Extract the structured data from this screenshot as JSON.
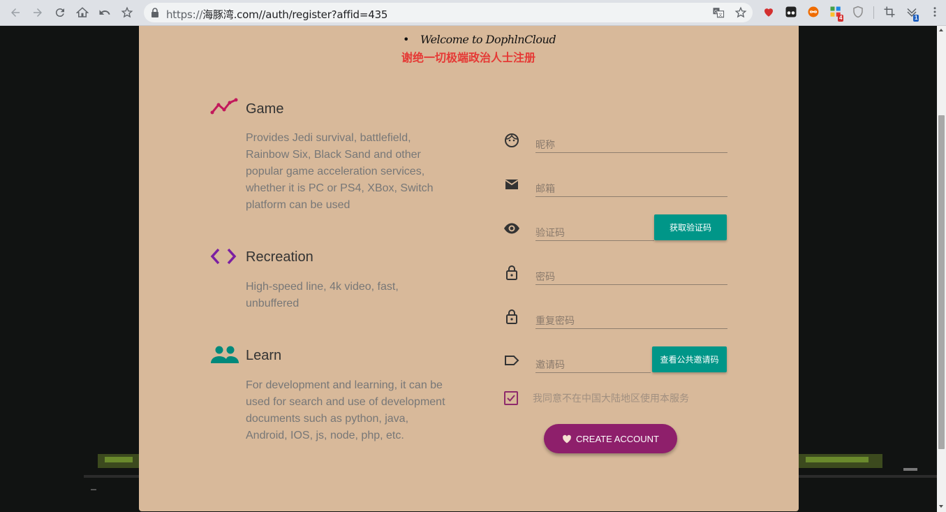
{
  "browser": {
    "url_scheme": "https://",
    "url_rest": "海豚湾.com//auth/register?affid=435",
    "ext_badge_1": "4",
    "ext_badge_2": "1",
    "icons": [
      "back-icon",
      "forward-icon",
      "reload-icon",
      "home-icon",
      "undo-icon",
      "star-icon",
      "lock-icon",
      "translate-icon",
      "bookmark-star-icon",
      "heart-extension-icon",
      "tampermonkey-icon",
      "infinity-extension-icon",
      "puzzle-extension-icon",
      "shield-extension-icon",
      "crop-icon",
      "download-extension-icon",
      "menu-icon"
    ]
  },
  "header": {
    "welcome": "Welcome to DophlnCloud",
    "warning": "谢绝一切极端政治人士注册"
  },
  "features": [
    {
      "title": "Game",
      "icon": "trending-icon",
      "color": "#c2185b",
      "desc": "Provides Jedi survival, battlefield, Rainbow Six, Black Sand and other popular game acceleration services, whether it is PC or PS4, XBox, Switch platform can be used"
    },
    {
      "title": "Recreation",
      "icon": "code-icon",
      "color": "#7b1fa2",
      "desc": "High-speed line, 4k video, fast, unbuffered"
    },
    {
      "title": "Learn",
      "icon": "people-icon",
      "color": "#00897b",
      "desc": "For development and learning, it can be used for search and use of development documents such as python, java, Android, IOS, js, node, php, etc."
    }
  ],
  "form": {
    "nickname_placeholder": "昵称",
    "email_placeholder": "邮箱",
    "code_placeholder": "验证码",
    "get_code_label": "获取验证码",
    "password_placeholder": "密码",
    "repeat_password_placeholder": "重复密码",
    "invite_placeholder": "邀请码",
    "view_invite_label": "查看公共邀请码",
    "agree_label": "我同意不在中国大陆地区使用本服务",
    "agree_checked": true,
    "create_label": "CREATE ACCOUNT"
  },
  "colors": {
    "card_bg": "#d8b99a",
    "teal": "#009688",
    "create_btn": "#8e1f6b",
    "warning": "#e53935"
  }
}
